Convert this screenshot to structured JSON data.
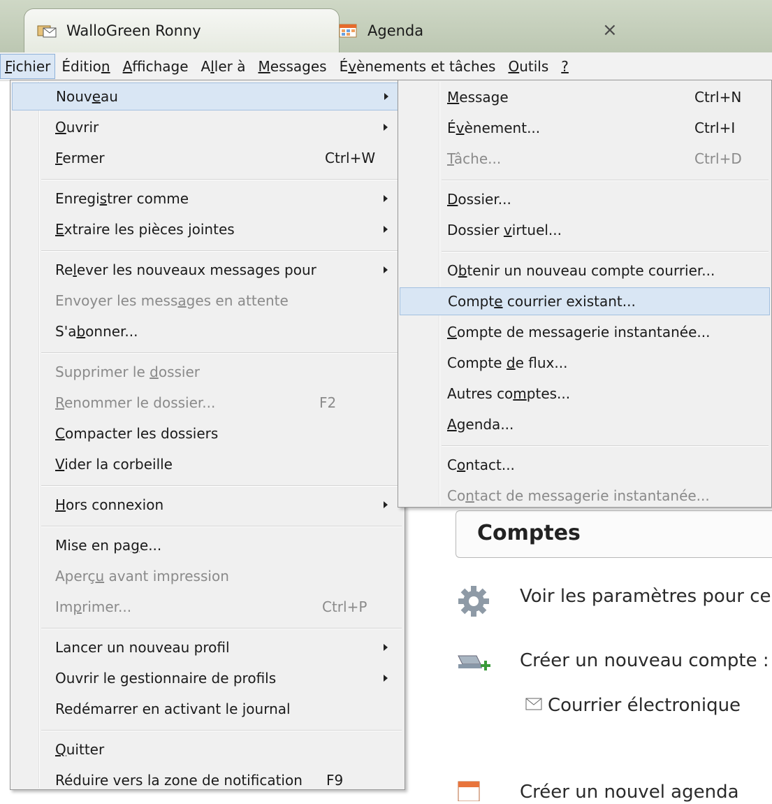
{
  "tabs": [
    {
      "label": "WalloGreen Ronny",
      "icon": "mail-folder-icon"
    },
    {
      "label": "Agenda",
      "icon": "calendar-icon"
    }
  ],
  "tab_close_glyph": "×",
  "menubar": [
    {
      "pre": "",
      "u": "F",
      "post": "ichier",
      "active": true
    },
    {
      "pre": "Éditio",
      "u": "n",
      "post": ""
    },
    {
      "pre": "",
      "u": "A",
      "post": "ffichage"
    },
    {
      "pre": "A",
      "u": "l",
      "post": "ler à"
    },
    {
      "pre": "",
      "u": "M",
      "post": "essages"
    },
    {
      "pre": "É",
      "u": "v",
      "post": "ènements et tâches"
    },
    {
      "pre": "",
      "u": "O",
      "post": "utils"
    },
    {
      "pre": "",
      "u": "?",
      "post": ""
    }
  ],
  "file_menu": {
    "items": [
      {
        "pre": "Nouv",
        "u": "e",
        "post": "au",
        "submenu": true,
        "highlighted": true
      },
      {
        "pre": "",
        "u": "O",
        "post": "uvrir",
        "submenu": true
      },
      {
        "pre": "",
        "u": "F",
        "post": "ermer",
        "shortcut": "Ctrl+W"
      },
      {
        "pre": "Enregi",
        "u": "s",
        "post": "trer comme",
        "submenu": true
      },
      {
        "pre": "",
        "u": "E",
        "post": "xtraire les pièces jointes",
        "submenu": true
      },
      {
        "pre": "Re",
        "u": "l",
        "post": "ever les nouveaux messages pour",
        "submenu": true
      },
      {
        "pre": "Envoyer les mess",
        "u": "a",
        "post": "ges en attente",
        "disabled": true
      },
      {
        "pre": "S'a",
        "u": "b",
        "post": "onner..."
      },
      {
        "pre": "Supprimer le ",
        "u": "d",
        "post": "ossier",
        "disabled": true
      },
      {
        "pre": "",
        "u": "R",
        "post": "enommer le dossier...",
        "shortcut": "F2",
        "disabled": true
      },
      {
        "pre": "",
        "u": "C",
        "post": "ompacter les dossiers"
      },
      {
        "pre": "",
        "u": "V",
        "post": "ider la corbeille"
      },
      {
        "pre": "",
        "u": "H",
        "post": "ors connexion",
        "submenu": true
      },
      {
        "pre": "Mise en pa",
        "u": "g",
        "post": "e..."
      },
      {
        "pre": "Aperç",
        "u": "u",
        "post": " avant impression",
        "disabled": true
      },
      {
        "pre": "Im",
        "u": "p",
        "post": "rimer...",
        "shortcut": "Ctrl+P",
        "disabled": true
      },
      {
        "pre": "Lancer un nouveau profil",
        "u": "",
        "post": "",
        "submenu": true
      },
      {
        "pre": "Ouvrir le gestionnaire de profils",
        "u": "",
        "post": "",
        "submenu": true
      },
      {
        "pre": "Redémarrer en activant le journal",
        "u": "",
        "post": ""
      },
      {
        "pre": "",
        "u": "Q",
        "post": "uitter"
      },
      {
        "pre": "Réduire vers la zone de notification",
        "u": "",
        "post": "",
        "shortcut": "F9"
      }
    ]
  },
  "new_submenu": {
    "items": [
      {
        "pre": "",
        "u": "M",
        "post": "essage",
        "shortcut": "Ctrl+N"
      },
      {
        "pre": "É",
        "u": "v",
        "post": "ènement...",
        "shortcut": "Ctrl+I"
      },
      {
        "pre": "",
        "u": "T",
        "post": "âche...",
        "shortcut": "Ctrl+D",
        "disabled": true
      },
      {
        "pre": "",
        "u": "D",
        "post": "ossier..."
      },
      {
        "pre": "Dossier ",
        "u": "v",
        "post": "irtuel..."
      },
      {
        "pre": "O",
        "u": "b",
        "post": "tenir un nouveau compte courrier..."
      },
      {
        "pre": "Compt",
        "u": "e",
        "post": " courrier existant...",
        "highlighted": true
      },
      {
        "pre": "",
        "u": "C",
        "post": "ompte de messagerie instantanée..."
      },
      {
        "pre": "Compte ",
        "u": "d",
        "post": "e flux..."
      },
      {
        "pre": "Autres co",
        "u": "m",
        "post": "ptes..."
      },
      {
        "pre": "",
        "u": "A",
        "post": "genda..."
      },
      {
        "pre": "C",
        "u": "o",
        "post": "ntact..."
      },
      {
        "pre": "Co",
        "u": "n",
        "post": "tact de messagerie instantanée...",
        "disabled": true
      }
    ]
  },
  "content": {
    "section_title": "Comptes",
    "view_settings": "Voir les paramètres pour ce",
    "create_account": "Créer un nouveau compte :",
    "email_link": "Courrier électronique",
    "create_calendar": "Créer un nouvel agenda"
  }
}
